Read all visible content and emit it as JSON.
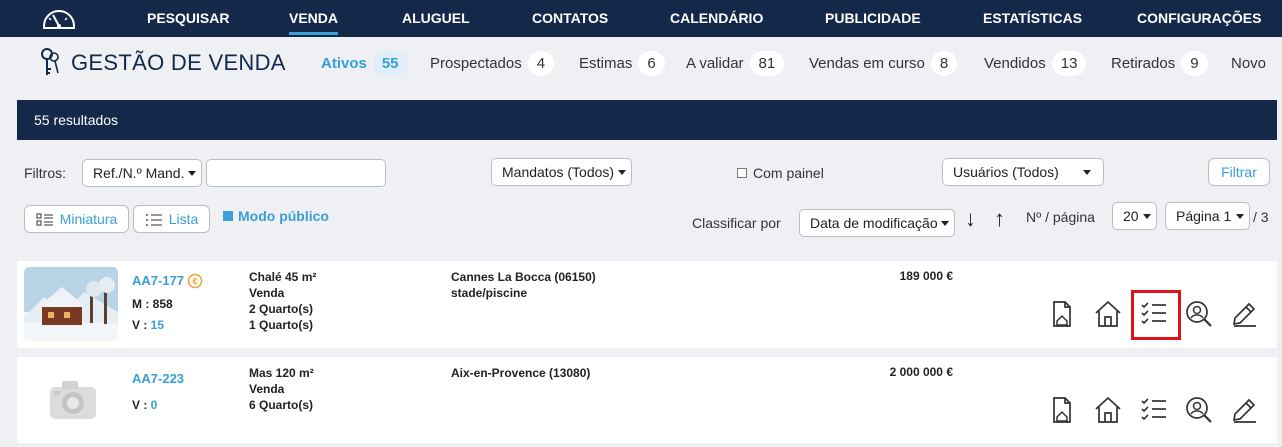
{
  "nav": {
    "items": [
      "PESQUISAR",
      "VENDA",
      "ALUGUEL",
      "CONTATOS",
      "CALENDÁRIO",
      "PUBLICIDADE",
      "ESTATÍSTICAS",
      "CONFIGURAÇÕES"
    ],
    "active": "VENDA"
  },
  "header": {
    "title": "GESTÃO DE VENDA",
    "tabs": [
      {
        "label": "Ativos",
        "count": "55"
      },
      {
        "label": "Prospectados",
        "count": "4"
      },
      {
        "label": "Estimas",
        "count": "6"
      },
      {
        "label": "A validar",
        "count": "81"
      },
      {
        "label": "Vendas em curso",
        "count": "8"
      },
      {
        "label": "Vendidos",
        "count": "13"
      },
      {
        "label": "Retirados",
        "count": "9"
      },
      {
        "label": "Novo",
        "count": ""
      }
    ]
  },
  "results": {
    "label": "55 resultados"
  },
  "filters": {
    "label": "Filtros:",
    "ref_select": "Ref./N.º Mand.",
    "ref_input_value": "",
    "mandates_select": "Mandatos (Todos)",
    "com_painel_label": "Com painel",
    "users_select": "Usuários (Todos)",
    "filter_button": "Filtrar"
  },
  "view": {
    "miniatura_label": "Miniatura",
    "lista_label": "Lista",
    "public_mode_label": "Modo público",
    "sort_label": "Classificar por",
    "sort_select": "Data de modificação",
    "per_page_label": "Nº / página",
    "per_page_select": "20",
    "page_select": "Página 1",
    "page_total": "/ 3"
  },
  "listings": [
    {
      "ref": "AA7-177",
      "m_label": "M : ",
      "m_value": "858",
      "v_label": "V : ",
      "v_value": "15",
      "type": "Chalé 45 m²",
      "transaction": "Venda",
      "rooms1": "2 Quarto(s)",
      "rooms2": "1 Quarto(s)",
      "location": "Cannes La Bocca (06150)",
      "location2": "stade/piscine",
      "price": "189 000 €"
    },
    {
      "ref": "AA7-223",
      "m_label": "",
      "m_value": "",
      "v_label": "V : ",
      "v_value": "0",
      "type": "Mas 120 m²",
      "transaction": "Venda",
      "rooms1": "6 Quarto(s)",
      "rooms2": "",
      "location": "Aix-en-Provence (13080)",
      "location2": "",
      "price": "2 000 000 €"
    }
  ],
  "colors": {
    "navy": "#14284a",
    "accent": "#3a9fd5",
    "highlight": "#e0111b"
  }
}
